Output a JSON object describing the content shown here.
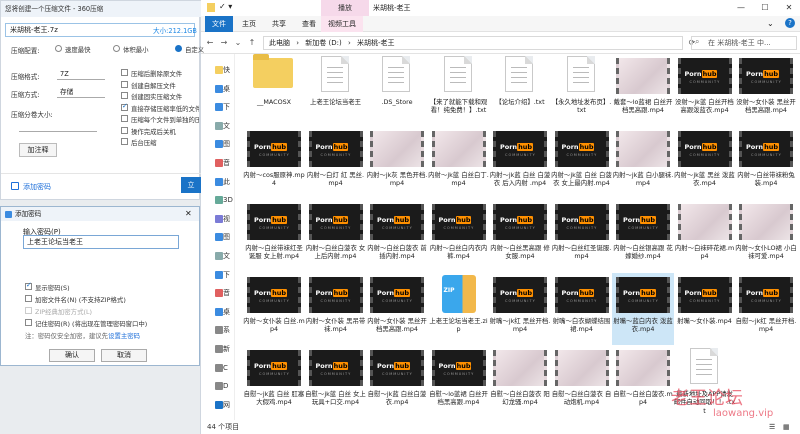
{
  "explorer": {
    "tool_tab": "播放",
    "title": "米胡桃-老王",
    "window_buttons": [
      "—",
      "☐",
      "✕"
    ],
    "ribbon_tabs": [
      "文件",
      "主页",
      "共享",
      "查看",
      "视频工具"
    ],
    "breadcrumb": [
      "此电脑",
      "›",
      "新加卷 (D:)",
      "›",
      "米胡桃-老王"
    ],
    "search_placeholder": "在 米胡桃-老王 中...",
    "nav_items": [
      "快",
      "桌",
      "下",
      "文",
      "图",
      "音",
      "此",
      "3D",
      "视",
      "图",
      "文",
      "下",
      "音",
      "桌",
      "系",
      "新",
      "C",
      "D",
      "网"
    ],
    "items": [
      {
        "type": "folder",
        "label": "__MACOSX"
      },
      {
        "type": "doc",
        "label": "上老王论坛当老王"
      },
      {
        "type": "doc",
        "label": ".DS_Store"
      },
      {
        "type": "doc",
        "label": "【来了就能下载和观看！纯免费！】.txt"
      },
      {
        "type": "doc",
        "label": "【论坛介绍】.txt"
      },
      {
        "type": "doc",
        "label": "【永久地址发布页】.txt"
      },
      {
        "type": "photo",
        "label": "戴套～lo蓝裙 白丝开档黑高跟.mp4"
      },
      {
        "type": "video",
        "label": "没射～jk蓝 白丝开档高跟泼蓝衣.mp4"
      },
      {
        "type": "video",
        "label": "没射～女仆装 黑丝开档黑高跟.mp4"
      },
      {
        "type": "video",
        "label": "内射～cos服原神.mp4"
      },
      {
        "type": "video",
        "label": "内射～白灯 紅 黑丝.mp4"
      },
      {
        "type": "photo",
        "label": "内射～jk灰 黑色开档.mp4"
      },
      {
        "type": "photo",
        "label": "内射～jk蓝 白丝白丁.mp4"
      },
      {
        "type": "video",
        "label": "内射～jk蓝 白丝 白菠衣 后入内射 .mp4"
      },
      {
        "type": "video",
        "label": "内射～jk蓝 白丝 白菠衣 女上最内射.mp4"
      },
      {
        "type": "photo",
        "label": "内射～jk蓝 白小腿袜.mp4"
      },
      {
        "type": "video",
        "label": "内射～jk蓝 黑丝 泼蓝衣.mp4"
      },
      {
        "type": "video",
        "label": "内射～白丝带袜粉兔装.mp4"
      },
      {
        "type": "video",
        "label": "内射～白丝带袜红圣诞服 女上射.mp4"
      },
      {
        "type": "video",
        "label": "内射～白丝白菠衣 女上后内射.mp4"
      },
      {
        "type": "video",
        "label": "内射～白丝白菠衣 前插内射.mp4"
      },
      {
        "type": "video",
        "label": "内射～白丝白内衣内裤.mp4"
      },
      {
        "type": "video",
        "label": "内射～白丝黑高跟 修女服.mp4"
      },
      {
        "type": "video",
        "label": "内射～白丝红圣诞服.mp4"
      },
      {
        "type": "video",
        "label": "内射～白丝银高跟 花嫁婚纱.mp4"
      },
      {
        "type": "photo",
        "label": "内射～白袜碎花裙.mp4"
      },
      {
        "type": "photo",
        "label": "内射～女仆LO裙 小白袜可爱.mp4"
      },
      {
        "type": "video",
        "label": "内射～女仆装 白丝.mp4"
      },
      {
        "type": "video",
        "label": "内射～女仆装 黑吊带袜.mp4"
      },
      {
        "type": "video",
        "label": "内射～女仆装 黑丝开档黑高跟.mp4"
      },
      {
        "type": "zip",
        "label": "上老王论坛当老王.zip"
      },
      {
        "type": "video",
        "label": "射嘴～jk红 黑丝开档.mp4"
      },
      {
        "type": "video",
        "label": "射嘴～白衣蝴蝶结围裙.mp4"
      },
      {
        "type": "video",
        "label": "射嘴～蓝白内衣 泼蓝衣.mp4",
        "selected": true
      },
      {
        "type": "video",
        "label": "射嘴～女仆装.mp4"
      },
      {
        "type": "video",
        "label": "自慰～jk红 黑丝开档.mp4"
      },
      {
        "type": "video",
        "label": "自慰～jk蓝 白丝 肛塞大假鸡.mp4"
      },
      {
        "type": "video",
        "label": "自慰～jk蓝 白丝 女上玩具+口交.mp4"
      },
      {
        "type": "video",
        "label": "自慰～jk蓝 白丝白菠衣.mp4"
      },
      {
        "type": "video",
        "label": "自慰～lo蓝裙 白丝开档黑高跟.mp4"
      },
      {
        "type": "photo",
        "label": "自慰～白丝白菠衣 阳幻龙骚.mp4"
      },
      {
        "type": "photo",
        "label": "自慰～白丝白菠衣 自动炮机.mp4"
      },
      {
        "type": "photo",
        "label": "自慰～白丝白菠衣.mp4"
      },
      {
        "type": "doc",
        "label": "最新地址及APP请发邮件自动回取！！ .txt"
      }
    ],
    "status": "44 个项目",
    "watermark": "老王论坛",
    "watermark_url": "laowang.vip"
  },
  "zip_dialog": {
    "title": "您将创建一个压缩文件 - 360压缩",
    "filename": "米胡桃-老王.7z",
    "size": "大小:212.1GB",
    "compress_label": "压缩配置:",
    "radio_fast": "速度最快",
    "radio_small": "体积最小",
    "radio_custom": "自定义",
    "format_label": "压缩格式:",
    "format_value": "7Z",
    "method_label": "压缩方式:",
    "method_value": "存储",
    "split_label": "压缩分卷大小:",
    "options": [
      "压缩后删除原文件",
      "创建自解压文件",
      "创建固实压缩文件",
      "直接存储压缩率低的文件",
      "压缩每个文件到单独的压缩",
      "操作完成后关机",
      "后台压缩"
    ],
    "options_checked": [
      false,
      false,
      false,
      true,
      false,
      false,
      false
    ],
    "password_button": "加注释",
    "add_pwd_link": "添加密码",
    "start_button": "立"
  },
  "password_dialog": {
    "title": "添加密码",
    "close": "✕",
    "prompt": "输入密码(P)",
    "value": "上老王论坛当老王",
    "show_pwd": "显示密码(S)",
    "encrypt_name": "加密文件名(N) (不支持ZIP格式)",
    "zip_compat": "ZIP经典加密方式(L)",
    "remember": "记住密码(R) (将出现在管理密码窗口中)",
    "note_prefix": "注：密码仅安全加密，建议先",
    "note_link": "设置主密码",
    "ok": "确认",
    "cancel": "取消"
  }
}
